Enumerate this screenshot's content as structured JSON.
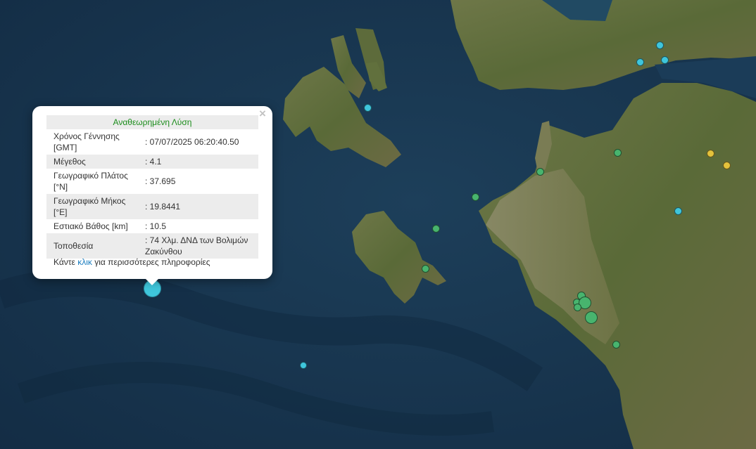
{
  "popup": {
    "header": "Αναθεωρημένη Λύση",
    "close_label": "×",
    "rows": [
      {
        "label": "Χρόνος Γέννησης [GMT]",
        "value": ": 07/07/2025 06:20:40.50"
      },
      {
        "label": "Μέγεθος",
        "value": ": 4.1"
      },
      {
        "label": "Γεωγραφικό Πλάτος [°N]",
        "value": ": 37.695"
      },
      {
        "label": "Γεωγραφικό Μήκος [°E]",
        "value": ": 19.8441"
      },
      {
        "label": "Εστιακό Βάθος [km]",
        "value": ": 10.5"
      },
      {
        "label": "Τοποθεσία",
        "value": ": 74 Χλμ. ΔΝΔ των Βολιμών Ζακύνθου"
      }
    ],
    "more_prefix": "Κάντε ",
    "more_link": "κλικ",
    "more_suffix": " για περισσότερες πληροφορίες"
  },
  "colors": {
    "cyan": "#3fc6dc",
    "green": "#48b46e",
    "yellow": "#e4c23c",
    "sea": "#17354f",
    "land": "#5c6a3a"
  }
}
